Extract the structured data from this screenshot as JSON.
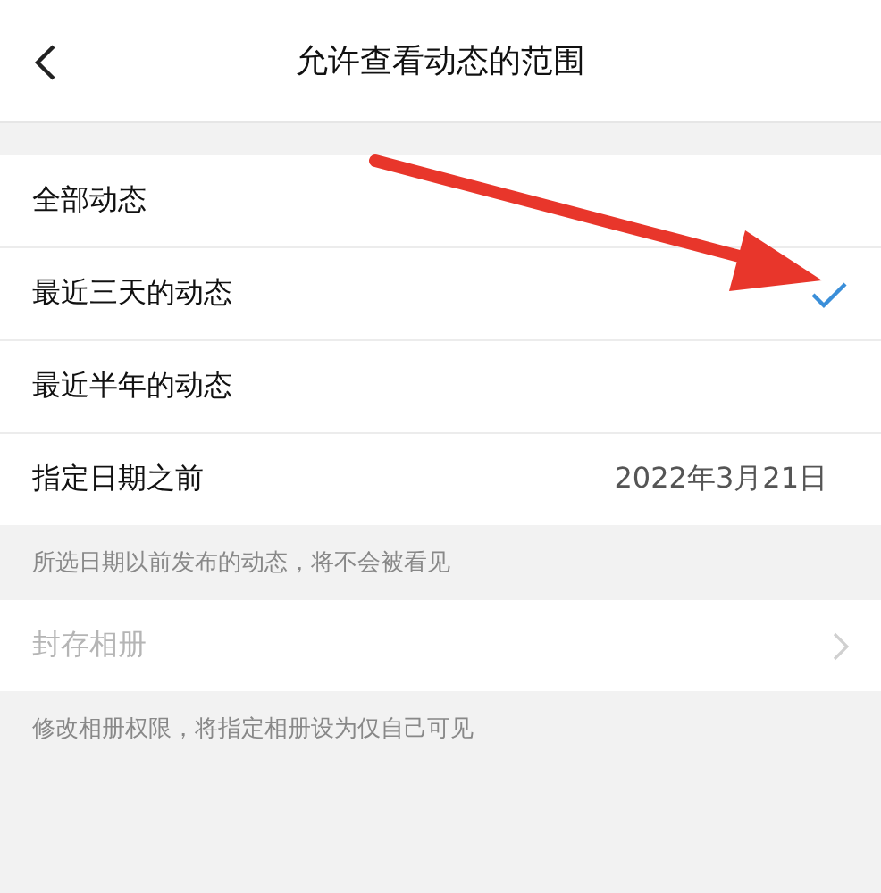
{
  "header": {
    "title": "允许查看动态的范围"
  },
  "options": [
    {
      "label": "全部动态",
      "selected": false
    },
    {
      "label": "最近三天的动态",
      "selected": true
    },
    {
      "label": "最近半年的动态",
      "selected": false
    }
  ],
  "date_row": {
    "label": "指定日期之前",
    "value": "2022年3月21日"
  },
  "date_note": "所选日期以前发布的动态，将不会被看见",
  "archive_row": {
    "label": "封存相册",
    "disabled": true
  },
  "archive_note": "修改相册权限，将指定相册设为仅自己可见",
  "annotation": {
    "kind": "arrow"
  }
}
